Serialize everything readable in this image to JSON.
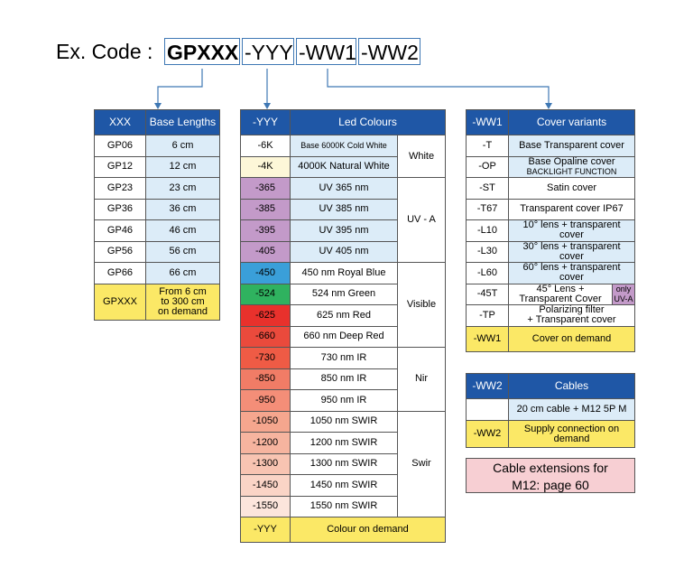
{
  "code": {
    "label": "Ex. Code :",
    "x": "GPXXX",
    "y": "-YYY",
    "w1": "-WW1",
    "w2": "-WW2"
  },
  "base": {
    "h1": "XXX",
    "h2": "Base Lengths",
    "rows": [
      [
        "GP06",
        "6 cm"
      ],
      [
        "GP12",
        "12 cm"
      ],
      [
        "GP23",
        "23 cm"
      ],
      [
        "GP36",
        "36 cm"
      ],
      [
        "GP46",
        "46 cm"
      ],
      [
        "GP56",
        "56 cm"
      ],
      [
        "GP66",
        "66 cm"
      ]
    ],
    "last": {
      "code": "GPXXX",
      "lines": [
        "From 6 cm",
        "to 300 cm",
        "on demand"
      ]
    }
  },
  "leds": {
    "h1": "-YYY",
    "h2": "Led Colours",
    "rows": [
      {
        "code": "-6K",
        "name": "Base 6000K Cold White",
        "color": "#ffffff"
      },
      {
        "code": "-4K",
        "name": "4000K Natural White",
        "color": "#fdf7d8"
      },
      {
        "code": "-365",
        "name": "UV 365 nm",
        "color": "#c39ac9"
      },
      {
        "code": "-385",
        "name": "UV 385 nm",
        "color": "#c39ac9"
      },
      {
        "code": "-395",
        "name": "UV 395 nm",
        "color": "#c39ac9"
      },
      {
        "code": "-405",
        "name": "UV 405 nm",
        "color": "#c39ac9"
      },
      {
        "code": "-450",
        "name": "450 nm Royal Blue",
        "color": "#3a9fd9"
      },
      {
        "code": "-524",
        "name": "524 nm Green",
        "color": "#2fb25f"
      },
      {
        "code": "-625",
        "name": "625 nm Red",
        "color": "#e8312c"
      },
      {
        "code": "-660",
        "name": "660 nm Deep Red",
        "color": "#ea4a3c"
      },
      {
        "code": "-730",
        "name": "730 nm IR",
        "color": "#ef5b45"
      },
      {
        "code": "-850",
        "name": "850 nm IR",
        "color": "#f17c66"
      },
      {
        "code": "-950",
        "name": "950 nm IR",
        "color": "#f48e78"
      },
      {
        "code": "-1050",
        "name": "1050 nm SWIR",
        "color": "#f5a68e"
      },
      {
        "code": "-1200",
        "name": "1200 nm SWIR",
        "color": "#f6b49f"
      },
      {
        "code": "-1300",
        "name": "1300 nm SWIR",
        "color": "#f8c4b2"
      },
      {
        "code": "-1450",
        "name": "1450 nm SWIR",
        "color": "#fad4c6"
      },
      {
        "code": "-1550",
        "name": "1550 nm SWIR",
        "color": "#fce5dc"
      }
    ],
    "groups": [
      {
        "label": "White",
        "span": 2
      },
      {
        "label": "UV - A",
        "span": 4
      },
      {
        "label": "Visible",
        "span": 4
      },
      {
        "label": "Nir",
        "span": 3
      },
      {
        "label": "Swir",
        "span": 5
      }
    ],
    "last": {
      "code": "-YYY",
      "name": "Colour on demand"
    }
  },
  "covers": {
    "h1": "-WW1",
    "h2": "Cover variants",
    "rows": [
      {
        "code": "-T",
        "lines": [
          "Base Transparent cover"
        ]
      },
      {
        "code": "-OP",
        "lines": [
          "Base Opaline cover"
        ],
        "small": "BACKLIGHT FUNCTION"
      },
      {
        "code": "-ST",
        "lines": [
          "Satin cover"
        ]
      },
      {
        "code": "-T67",
        "lines": [
          "Transparent cover IP67"
        ]
      },
      {
        "code": "-L10",
        "lines": [
          "10° lens + transparent",
          "cover"
        ]
      },
      {
        "code": "-L30",
        "lines": [
          "30° lens + transparent",
          "cover"
        ]
      },
      {
        "code": "-L60",
        "lines": [
          "60° lens + transparent",
          "cover"
        ]
      },
      {
        "code": "-TP",
        "lines": [
          "Polarizing filter",
          "+ Transparent cover"
        ]
      }
    ],
    "row45": {
      "code": "-45T",
      "lines": [
        "45° Lens +",
        "Transparent Cover"
      ],
      "tag": [
        "only",
        "UV-A"
      ]
    },
    "last": {
      "code": "-WW1",
      "name": "Cover on demand"
    }
  },
  "cables": {
    "h1": "-WW2",
    "h2": "Cables",
    "row1": "20 cm cable + M12 5P M",
    "last": {
      "code": "-WW2",
      "lines": [
        "Supply connection on",
        "demand"
      ]
    }
  },
  "note": {
    "lines": [
      "Cable extensions for",
      "M12: page 60"
    ]
  },
  "colors": {
    "header": "#1f57a6",
    "lightblue": "#dcecf8",
    "yellow": "#fbe866",
    "pink": "#f7cfd3",
    "connector": "#3f78b4"
  }
}
